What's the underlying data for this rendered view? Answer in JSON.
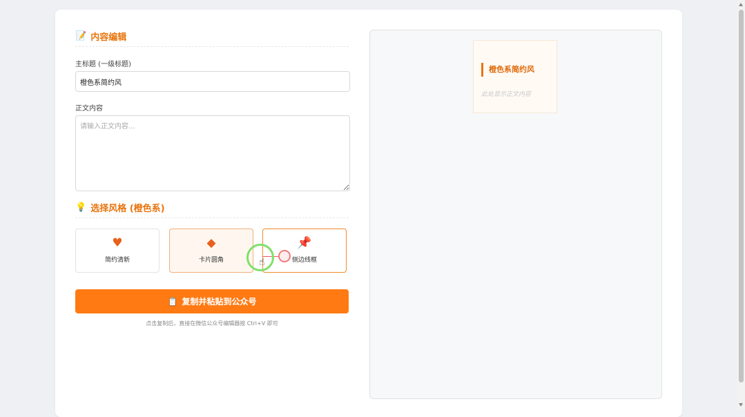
{
  "editor": {
    "section_title": "内容编辑",
    "section_icon": "memo-icon",
    "title_label": "主标题 (一级标题)",
    "title_value": "橙色系简约风",
    "body_label": "正文内容",
    "body_placeholder": "请输入正文内容..."
  },
  "style": {
    "section_title": "选择风格 (橙色系)",
    "section_icon": "lightbulb-icon",
    "options": [
      {
        "label": "简约清新",
        "icon": "heart-icon",
        "glyph": "♥"
      },
      {
        "label": "卡片圆角",
        "icon": "diamond-icon",
        "glyph": "◆"
      },
      {
        "label": "侧边线框",
        "icon": "pushpin-icon",
        "glyph": "📌"
      }
    ]
  },
  "actions": {
    "copy_button": "复制并粘贴到公众号",
    "copy_icon": "clipboard-icon",
    "hint": "点击复制后，直接在微信公众号编辑器按 Ctrl+V 即可"
  },
  "preview": {
    "title": "橙色系简约风",
    "body_placeholder": "此处显示正文内容"
  },
  "colors": {
    "accent": "#e8740c",
    "button": "#ff7a12"
  }
}
